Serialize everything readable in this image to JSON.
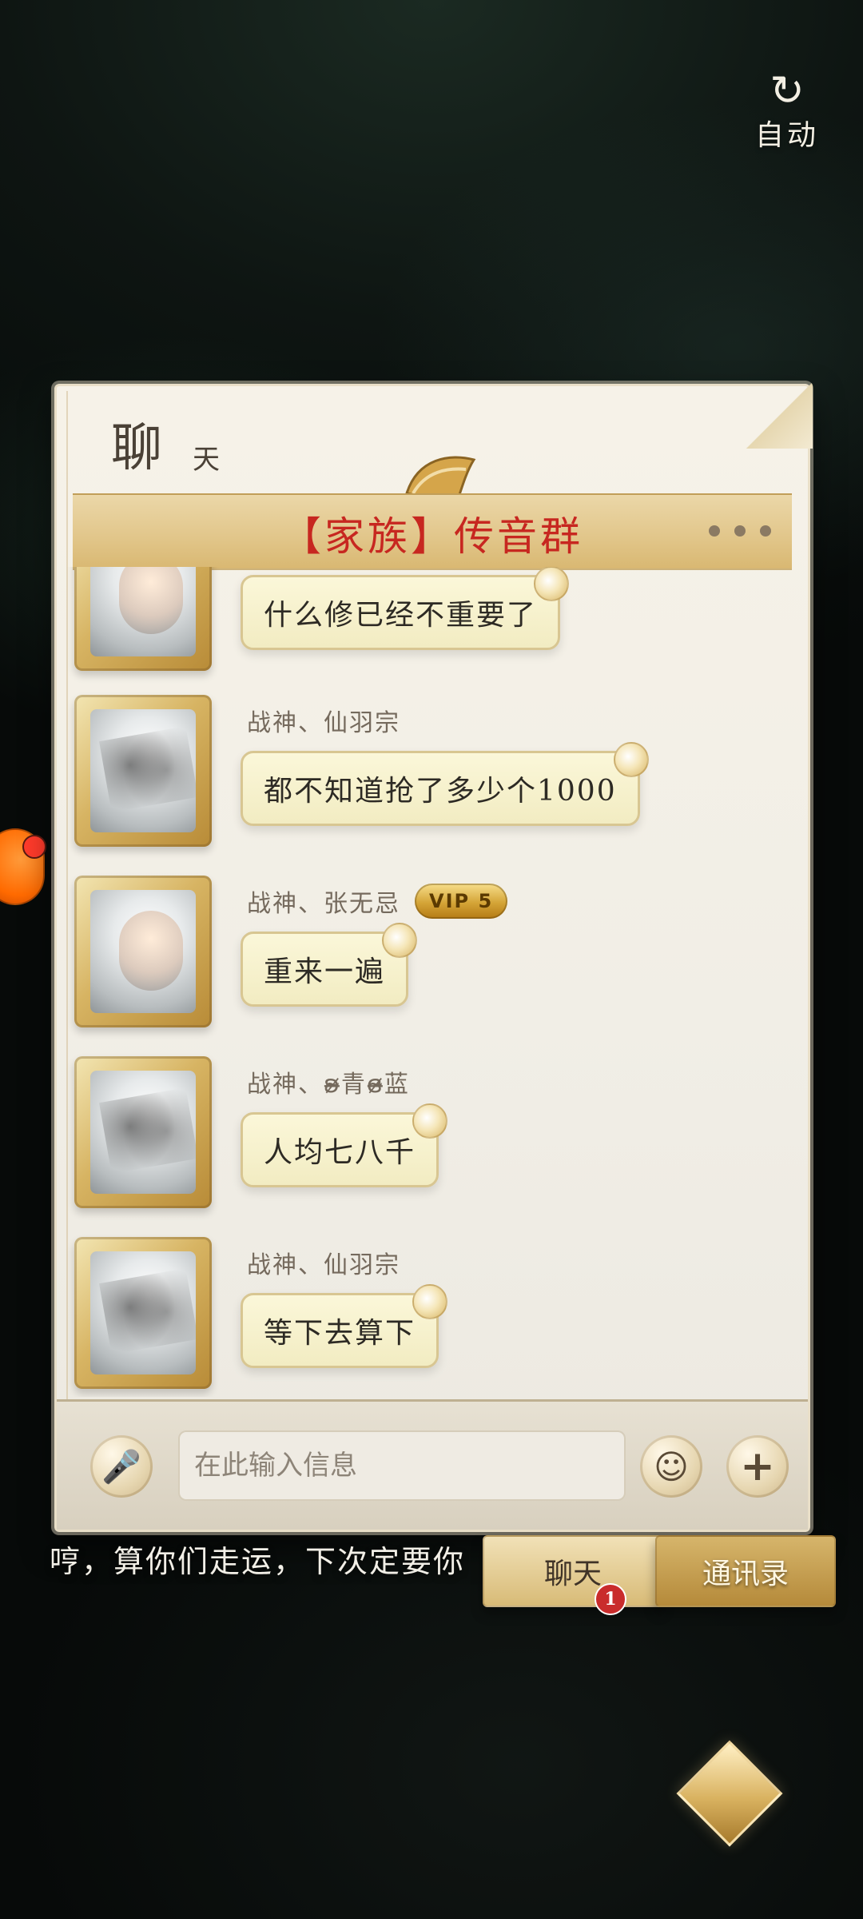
{
  "top_right": {
    "auto_label": "自动",
    "icon": "refresh-icon"
  },
  "panel": {
    "title_main": "聊",
    "title_sub": "天",
    "group_title": "【家族】传音群",
    "more_icon": "more-dots-icon"
  },
  "messages": [
    {
      "name": "",
      "vip": "",
      "text": "什么修已经不重要了",
      "avatar": "avatar-human"
    },
    {
      "name": "战神、仙羽宗",
      "vip": "",
      "text": "都不知道抢了多少个1000",
      "avatar": "avatar-dragon"
    },
    {
      "name": "战神、张无忌",
      "vip": "VIP 5",
      "text": "重来一遍",
      "avatar": "avatar-human"
    },
    {
      "name": "战神、ʚ̴̶̷青ɞ̴̶̷蓝",
      "vip": "",
      "text": "人均七八千",
      "avatar": "avatar-dragon"
    },
    {
      "name": "战神、仙羽宗",
      "vip": "",
      "text": "等下去算下",
      "avatar": "avatar-dragon"
    }
  ],
  "input": {
    "placeholder": "在此输入信息",
    "mic_icon": "microphone-icon",
    "emoji_icon": "emoji-icon",
    "plus_icon": "plus-icon"
  },
  "subtitle": "哼，算你们走运，下次定要你",
  "tabs": {
    "chat_label": "聊天",
    "chat_badge": "1",
    "contacts_label": "通讯录"
  }
}
